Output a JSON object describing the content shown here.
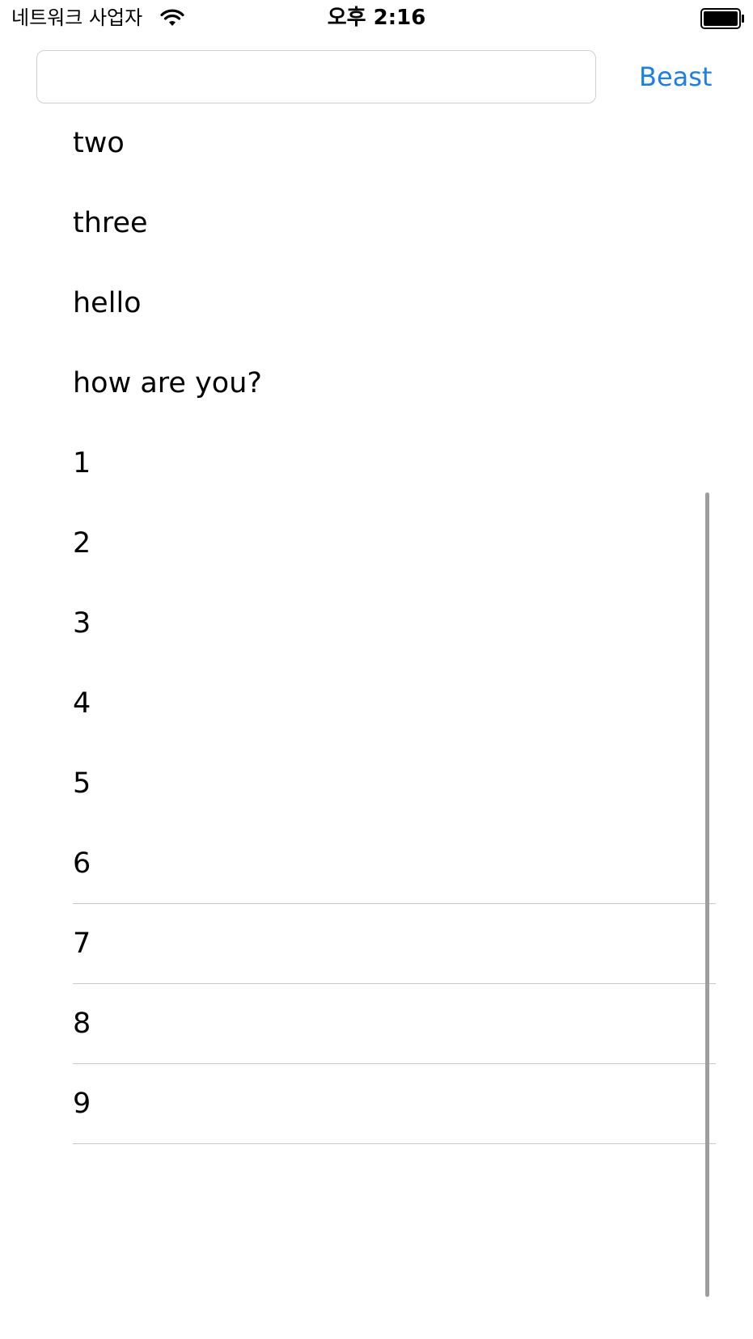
{
  "status_bar": {
    "carrier": "네트워크 사업자",
    "time": "오후 2:16",
    "wifi_icon": "wifi-icon",
    "battery_icon": "battery-icon"
  },
  "search": {
    "value": "",
    "placeholder": ""
  },
  "action_button": {
    "label": "Beast",
    "color": "#1a7fe6"
  },
  "list": {
    "items": [
      "two",
      "three",
      "hello",
      "how are you?",
      "1",
      "2",
      "3",
      "4",
      "5",
      "6",
      "7",
      "8",
      "9"
    ]
  }
}
